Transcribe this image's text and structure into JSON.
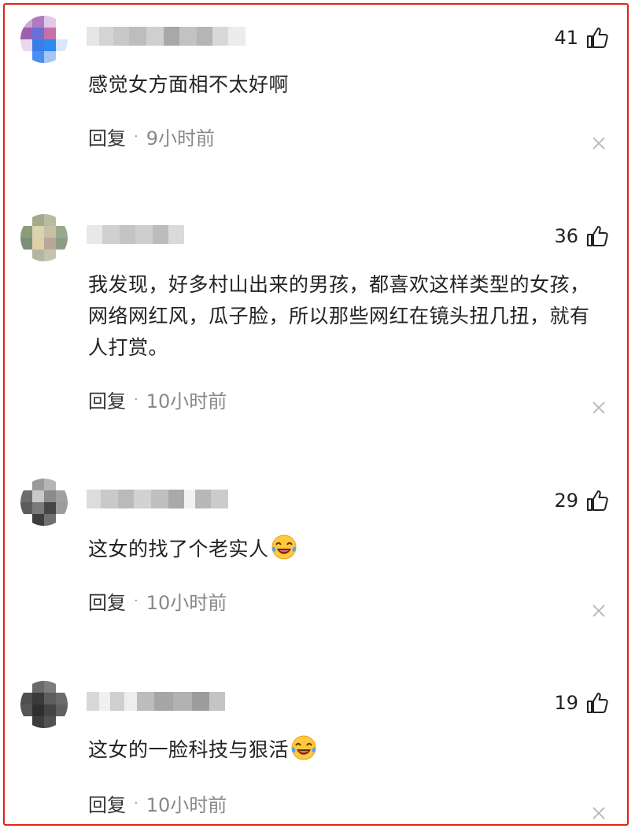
{
  "comments": [
    {
      "likes": "41",
      "text": "感觉女方面相不太好啊",
      "reply_label": "回复",
      "separator": "·",
      "time": "9小时前",
      "has_emoji": false
    },
    {
      "likes": "36",
      "text": "我发现，好多村山出来的男孩，都喜欢这样类型的女孩，网络网红风，瓜子脸，所以那些网红在镜头扭几扭，就有人打赏。",
      "reply_label": "回复",
      "separator": "·",
      "time": "10小时前",
      "has_emoji": false
    },
    {
      "likes": "29",
      "text": "这女的找了个老实人",
      "reply_label": "回复",
      "separator": "·",
      "time": "10小时前",
      "has_emoji": true
    },
    {
      "likes": "19",
      "text": "这女的一脸科技与狠活",
      "reply_label": "回复",
      "separator": "·",
      "time": "10小时前",
      "has_emoji": true
    }
  ],
  "icons": {
    "like": "thumbs-up-icon",
    "close": "close-icon",
    "emoji": "laughing-crying-emoji-icon"
  },
  "colors": {
    "border": "#e3241b",
    "text": "#222222",
    "meta_time": "#888888",
    "close_icon": "#bbbbbb"
  }
}
